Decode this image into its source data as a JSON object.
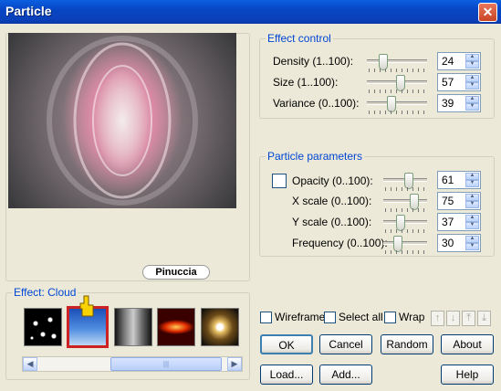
{
  "window": {
    "title": "Particle",
    "close_glyph": "✕"
  },
  "preview": {
    "stamp_text": "Pinuccia"
  },
  "effect_control": {
    "title": "Effect control",
    "rows": [
      {
        "label": "Density (1..100):",
        "value": "24",
        "level_pct": 24
      },
      {
        "label": "Size (1..100):",
        "value": "57",
        "level_pct": 57
      },
      {
        "label": "Variance (0..100):",
        "value": "39",
        "level_pct": 39
      }
    ]
  },
  "particle_parameters": {
    "title": "Particle parameters",
    "rows": [
      {
        "label": "Opacity (0..100):",
        "value": "61",
        "level_pct": 61
      },
      {
        "label": "X scale (0..100):",
        "value": "75",
        "level_pct": 75
      },
      {
        "label": "Y scale (0..100):",
        "value": "37",
        "level_pct": 37
      },
      {
        "label": "Frequency (0..100):",
        "value": "30",
        "level_pct": 30
      }
    ]
  },
  "effect_gallery": {
    "title": "Effect: Cloud",
    "thumbnails": [
      "dust",
      "cloud",
      "smoke",
      "fire",
      "star"
    ],
    "selected": "cloud",
    "scroll_thumb_glyph": "|||"
  },
  "options": {
    "wireframe": "Wireframe",
    "select_all": "Select all",
    "wrap": "Wrap"
  },
  "buttons": {
    "ok": "OK",
    "cancel": "Cancel",
    "random": "Random",
    "about": "About",
    "load": "Load...",
    "add": "Add...",
    "help": "Help"
  },
  "icons": {
    "spin_up": "▲",
    "spin_down": "▼",
    "scroll_left": "◀",
    "scroll_right": "▶",
    "nav_up": "↑",
    "nav_down": "↓",
    "nav_top": "⤒",
    "nav_bottom": "⤓"
  },
  "colors": {
    "accent": "#0046D5",
    "title_bar": "#0A5FE0",
    "selected_border": "#CC2222"
  }
}
